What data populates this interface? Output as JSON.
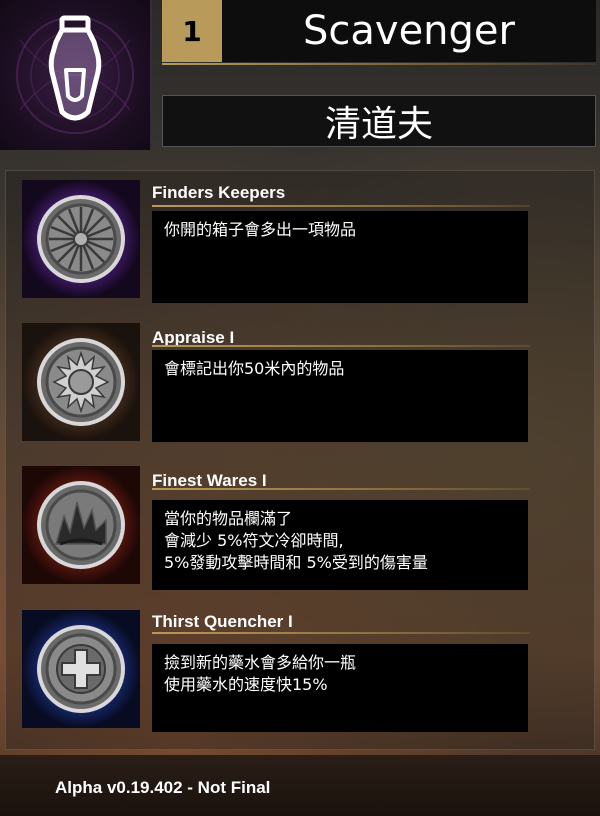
{
  "header": {
    "rank": "1",
    "title": "Scavenger",
    "subtitle": "清道夫",
    "icon": "potion-icon"
  },
  "perks": [
    {
      "name": "Finders Keepers",
      "icon": "finders-keepers-icon",
      "glow": "#7a35c8",
      "lines": [
        "你開的箱子會多出一項物品"
      ]
    },
    {
      "name": "Appraise I",
      "icon": "appraise-icon",
      "glow": "#8a5a2a",
      "lines": [
        "會標記出你50米內的物品"
      ]
    },
    {
      "name": "Finest Wares I",
      "icon": "finest-wares-icon",
      "glow": "#c0301c",
      "lines": [
        "當你的物品欄滿了",
        "會減少 5%符文冷卻時間,",
        "5%發動攻擊時間和 5%受到的傷害量"
      ]
    },
    {
      "name": "Thirst Quencher I",
      "icon": "thirst-quencher-icon",
      "glow": "#2850d0",
      "lines": [
        "撿到新的藥水會多給你一瓶",
        "使用藥水的速度快15%"
      ]
    }
  ],
  "footer": {
    "version": "Alpha v0.19.402 - Not Final"
  }
}
